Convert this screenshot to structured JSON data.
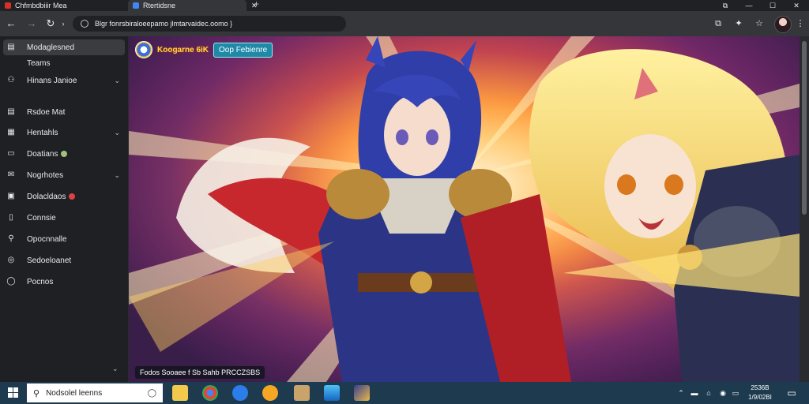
{
  "browser": {
    "tabs": [
      {
        "title": "Chfmbdbiiir Mea",
        "favicon_color": "#d93025"
      },
      {
        "title": "Rtertidsne",
        "favicon_color": "#4285f4"
      }
    ],
    "new_tab_symbol": "+",
    "url": "Blgr fonrsbiraloeepamo jlmtarvaidec.oomo }",
    "window_controls": [
      "⧉",
      "—",
      "☐",
      "✕"
    ]
  },
  "sidebar": {
    "items": [
      {
        "label": "Modaglesned",
        "icon": "panel-icon",
        "glyph": "▤",
        "active": true
      },
      {
        "label": "Teams",
        "icon": "none",
        "glyph": ""
      },
      {
        "label": "Hinans Janioe",
        "icon": "people-icon",
        "glyph": "⚇",
        "chevron": true
      },
      {
        "label": "Rsdoe Mat",
        "icon": "list-icon",
        "glyph": "▤"
      },
      {
        "label": "Hentahls",
        "icon": "grid-icon",
        "glyph": "▦",
        "chevron": true
      },
      {
        "label": "Doatians",
        "icon": "chat-icon",
        "glyph": "▭",
        "badge_color": "#a0c080"
      },
      {
        "label": "Nogrhotes",
        "icon": "mail-icon",
        "glyph": "✉",
        "chevron": true
      },
      {
        "label": "Dolacldaos",
        "icon": "image-icon",
        "glyph": "▣",
        "badge_color": "#e04040"
      },
      {
        "label": "Connsie",
        "icon": "book-icon",
        "glyph": "▯"
      },
      {
        "label": "Opocnnalle",
        "icon": "search-icon",
        "glyph": "⚲"
      },
      {
        "label": "Sedoeloanet",
        "icon": "settings-icon",
        "glyph": "◎"
      },
      {
        "label": "Pocnos",
        "icon": "help-icon",
        "glyph": "◯"
      }
    ],
    "scroll_chevron": "⌄"
  },
  "main": {
    "badge_title": "Koogarne 6iK",
    "badge_button": "Oop Febienre",
    "caption": "Fodos Sooaee f Sb Sahb  PRCCZSBS"
  },
  "taskbar": {
    "search_text": "Nodsolel leenns",
    "clock_line1": "2536B",
    "clock_line2": "1/9/02BI",
    "tray_icons": [
      "⌃",
      "▬",
      "⌂",
      "◉",
      "▭"
    ]
  }
}
